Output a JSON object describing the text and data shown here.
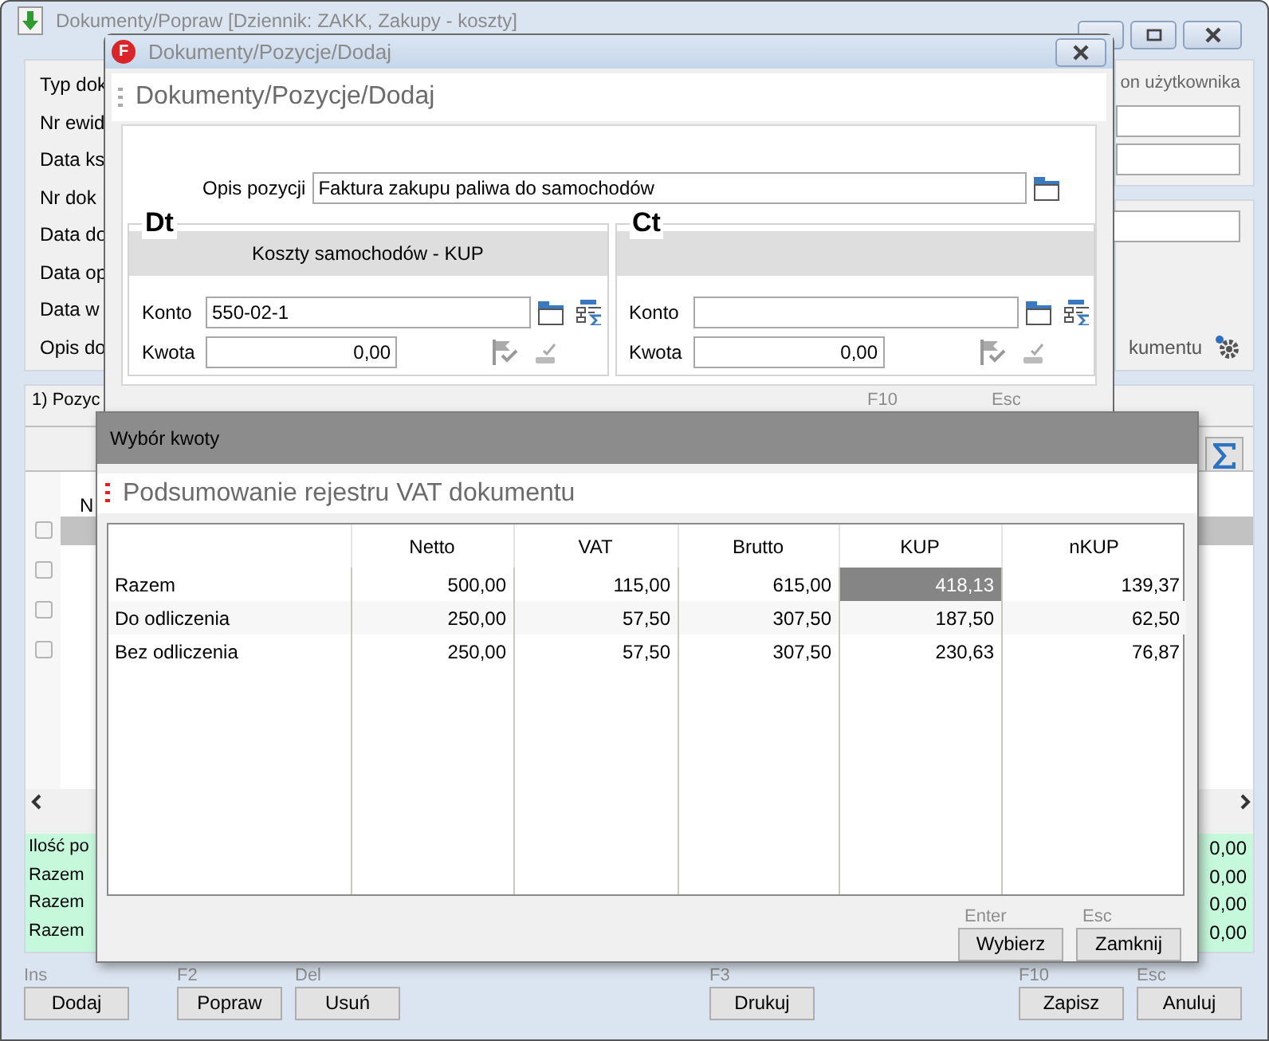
{
  "main_window": {
    "title": "Dokumenty/Popraw [Dziennik: ZAKK, Zakupy - koszty]",
    "field_labels": [
      "Typ dok",
      "Nr ewid",
      "Data ks",
      "Nr dok",
      "Data do",
      "Data op",
      "Data w",
      "Opis do"
    ],
    "template_label": "on użytkownika",
    "document_label": "kumentu",
    "tab": "1) Pozyc",
    "column_1": "N",
    "rows": [
      {
        "checked": false,
        "selected": true
      },
      {
        "checked": false,
        "selected": false
      },
      {
        "checked": false,
        "selected": false
      },
      {
        "checked": false,
        "selected": false
      }
    ],
    "summary": [
      {
        "label": "Ilość po",
        "value": "0,00"
      },
      {
        "label": "Razem",
        "value": "0,00"
      },
      {
        "label": "Razem",
        "value": "0,00"
      },
      {
        "label": "Razem",
        "value": "0,00"
      }
    ],
    "buttons": [
      {
        "hotkey": "Ins",
        "label": "Dodaj"
      },
      {
        "hotkey": "F2",
        "label": "Popraw"
      },
      {
        "hotkey": "Del",
        "label": "Usuń"
      },
      {
        "hotkey": "F3",
        "label": "Drukuj"
      },
      {
        "hotkey": "F10",
        "label": "Zapisz"
      },
      {
        "hotkey": "Esc",
        "label": "Anuluj"
      }
    ]
  },
  "position_dialog": {
    "icon_letter": "F",
    "title": "Dokumenty/Pozycje/Dodaj",
    "heading": "Dokumenty/Pozycje/Dodaj",
    "description_label": "Opis pozycji",
    "description_value": "Faktura zakupu paliwa do samochodów",
    "sides": [
      {
        "label": "Dt",
        "account_name": "Koszty samochodów  - KUP",
        "konto_label": "Konto",
        "konto_value": "550-02-1",
        "kwota_label": "Kwota",
        "kwota_value": "0,00"
      },
      {
        "label": "Ct",
        "konto_label": "Konto",
        "kwota_label": "Kwota",
        "kwota_value": "0,00"
      }
    ],
    "hotkeys": [
      "F10",
      "Esc"
    ]
  },
  "amount_dialog": {
    "title": "Wybór kwoty",
    "heading": "Podsumowanie rejestru VAT dokumentu",
    "columns": [
      "Netto",
      "VAT",
      "Brutto",
      "KUP",
      "nKUP"
    ],
    "rows": [
      {
        "label": "Razem",
        "cells": [
          {
            "text": "500,00",
            "selected": false
          },
          {
            "text": "115,00",
            "selected": false
          },
          {
            "text": "615,00",
            "selected": false
          },
          {
            "text": "418,13",
            "selected": true
          },
          {
            "text": "139,37",
            "selected": false
          }
        ]
      },
      {
        "label": "Do odliczenia",
        "cells": [
          {
            "text": "250,00",
            "selected": false
          },
          {
            "text": "57,50",
            "selected": false
          },
          {
            "text": "307,50",
            "selected": false
          },
          {
            "text": "187,50",
            "selected": false
          },
          {
            "text": "62,50",
            "selected": false
          }
        ]
      },
      {
        "label": "Bez odliczenia",
        "cells": [
          {
            "text": "250,00",
            "selected": false
          },
          {
            "text": "57,50",
            "selected": false
          },
          {
            "text": "307,50",
            "selected": false
          },
          {
            "text": "230,63",
            "selected": false
          },
          {
            "text": "76,87",
            "selected": false
          }
        ]
      }
    ],
    "buttons": [
      {
        "hotkey": "Enter",
        "label": "Wybierz"
      },
      {
        "hotkey": "Esc",
        "label": "Zamknij"
      }
    ]
  }
}
